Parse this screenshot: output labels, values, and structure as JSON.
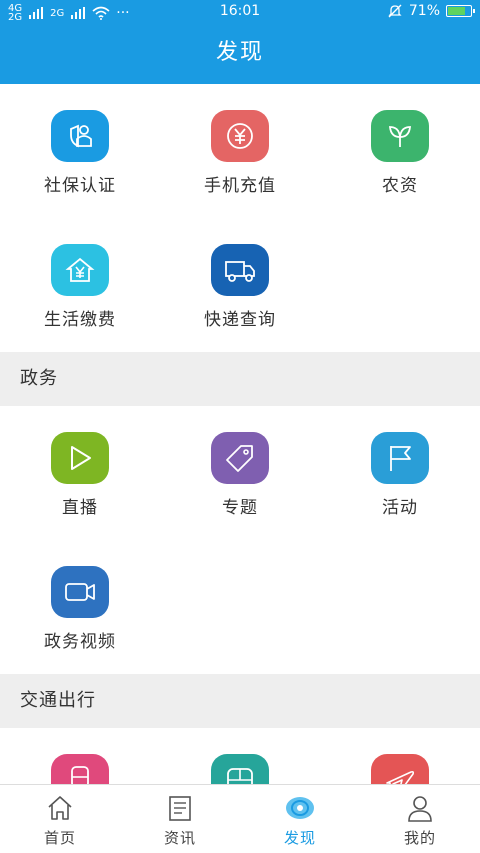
{
  "status_bar": {
    "network_top": "4G",
    "network_bottom": "2G",
    "network2_top": "2G",
    "more": "···",
    "time": "16:01",
    "battery_percent": "71%",
    "battery_level": 0.71
  },
  "header": {
    "title": "发现"
  },
  "sections": {
    "top": {
      "items": [
        {
          "label": "社保认证",
          "color": "#1a9be2",
          "icon": "shield-person-icon"
        },
        {
          "label": "手机充值",
          "color": "#e46564",
          "icon": "yen-coin-icon"
        },
        {
          "label": "农资",
          "color": "#3cb46d",
          "icon": "sprout-icon"
        },
        {
          "label": "生活缴费",
          "color": "#2cc1e2",
          "icon": "house-yen-icon"
        },
        {
          "label": "快递查询",
          "color": "#1763b3",
          "icon": "truck-icon"
        }
      ]
    },
    "zhengwu": {
      "title": "政务",
      "items": [
        {
          "label": "直播",
          "color": "#7eb623",
          "icon": "play-icon"
        },
        {
          "label": "专题",
          "color": "#7f5fb0",
          "icon": "tag-icon"
        },
        {
          "label": "活动",
          "color": "#2a9ed7",
          "icon": "flag-icon"
        },
        {
          "label": "政务视频",
          "color": "#2e72c0",
          "icon": "video-camera-icon"
        }
      ]
    },
    "jiaotong": {
      "title": "交通出行",
      "items": [
        {
          "color": "#e0497c",
          "icon": "train-icon"
        },
        {
          "color": "#26a59a",
          "icon": "bus-icon"
        },
        {
          "color": "#e45555",
          "icon": "plane-icon"
        }
      ]
    }
  },
  "tabs": [
    {
      "label": "首页",
      "icon": "home-icon"
    },
    {
      "label": "资讯",
      "icon": "news-icon"
    },
    {
      "label": "发现",
      "icon": "discover-icon",
      "active": true
    },
    {
      "label": "我的",
      "icon": "user-icon"
    }
  ]
}
